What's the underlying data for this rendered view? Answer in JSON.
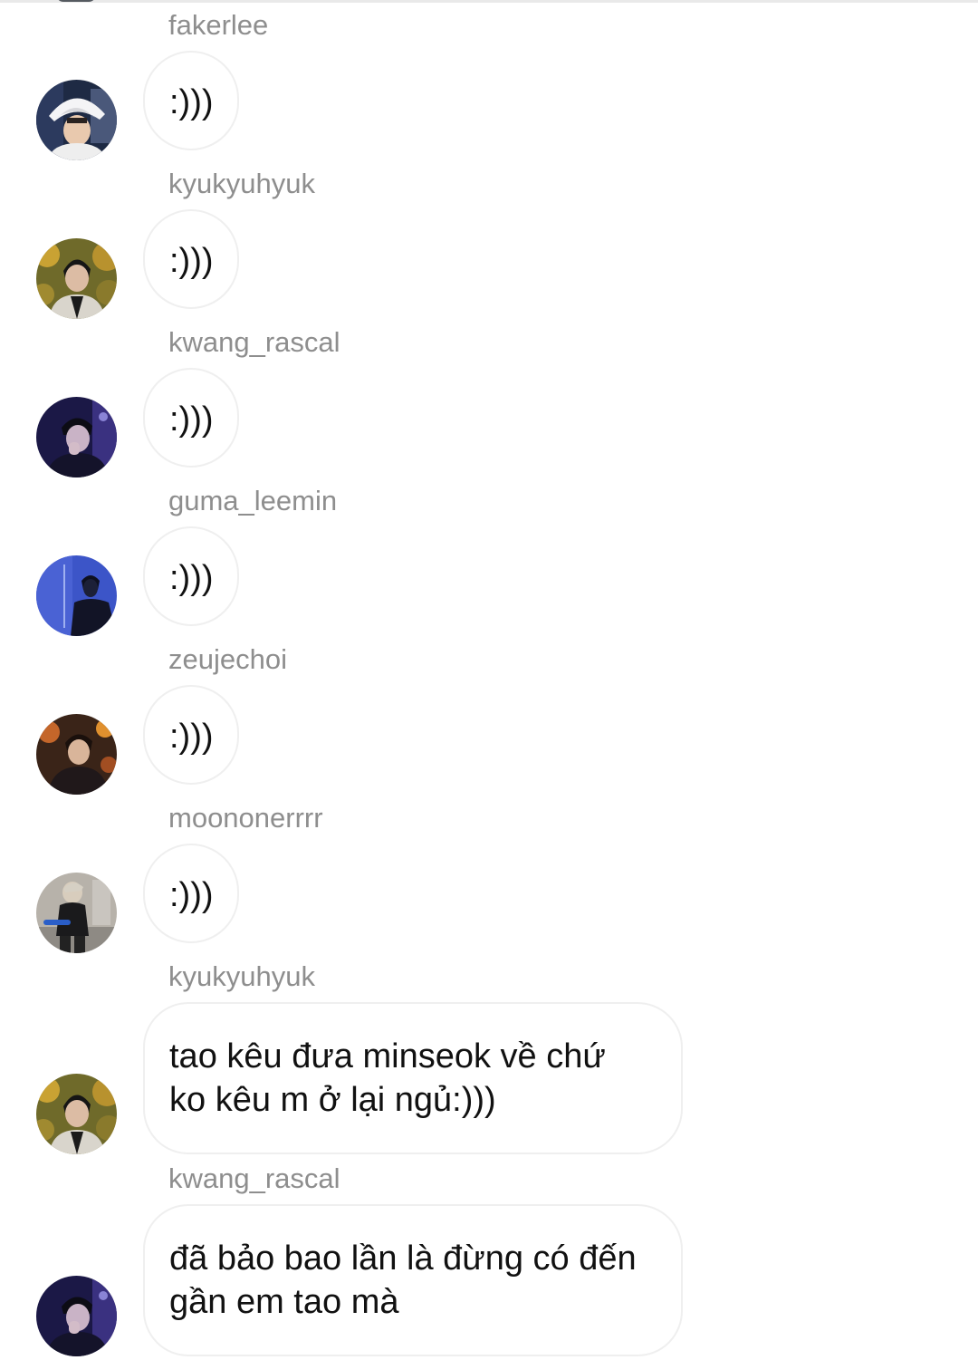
{
  "colors": {
    "background": "#ffffff",
    "username_text": "#8e8e8e",
    "message_text": "#111111",
    "bubble_border": "#efefef"
  },
  "messages": [
    {
      "username": "fakerlee",
      "text": ":)))",
      "avatar_icon": "user-photo-white-bucket-hat"
    },
    {
      "username": "kyukyuhyuk",
      "text": ":)))",
      "avatar_icon": "user-photo-autumn-leaves"
    },
    {
      "username": "kwang_rascal",
      "text": ":)))",
      "avatar_icon": "user-photo-dark-purple-stage"
    },
    {
      "username": "guma_leemin",
      "text": ":)))",
      "avatar_icon": "user-photo-blue-suit"
    },
    {
      "username": "zeujechoi",
      "text": ":)))",
      "avatar_icon": "user-photo-warm-lights"
    },
    {
      "username": "moononerrrr",
      "text": ":)))",
      "avatar_icon": "user-photo-gym"
    },
    {
      "username": "kyukyuhyuk",
      "text": "tao kêu đưa minseok về chứ ko kêu m ở lại ngủ:)))",
      "avatar_icon": "user-photo-autumn-leaves"
    },
    {
      "username": "kwang_rascal",
      "text": "đã bảo bao lần là đừng có đến gần em tao mà",
      "avatar_icon": "user-photo-dark-purple-stage"
    }
  ]
}
